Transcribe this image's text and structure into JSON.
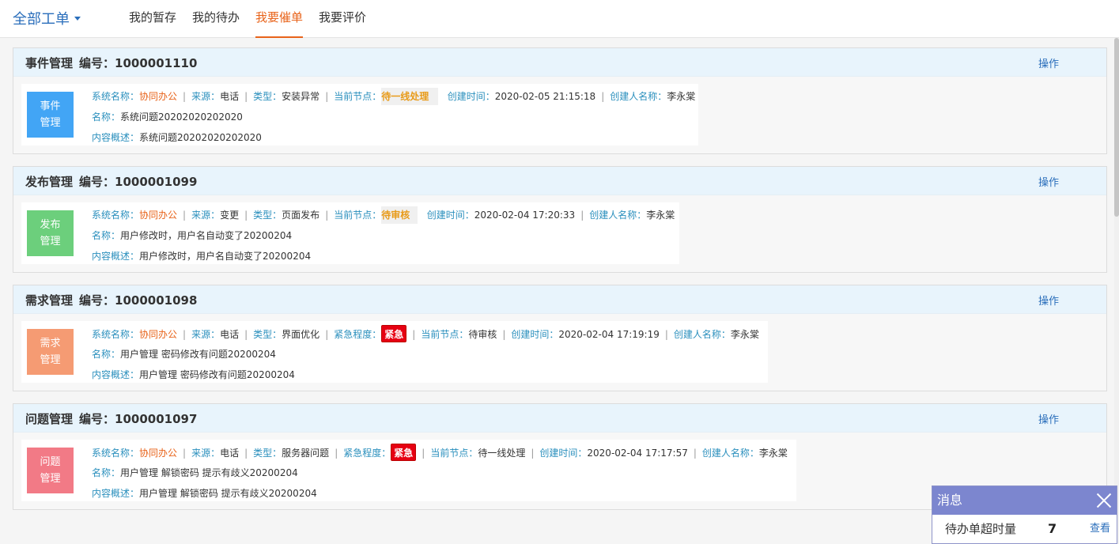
{
  "header": {
    "dropdown_label": "全部工单",
    "tabs": [
      {
        "label": "我的暂存"
      },
      {
        "label": "我的待办"
      },
      {
        "label": "我要催单"
      },
      {
        "label": "我要评价"
      }
    ]
  },
  "labels": {
    "number": "编号：",
    "operation": "操作",
    "system_name": "系统名称：",
    "source": "来源：",
    "type": "类型：",
    "current_node": "当前节点：",
    "urgency": "紧急程度：",
    "create_time": "创建时间：",
    "creator": "创建人名称：",
    "name": "名称：",
    "summary": "内容概述：",
    "separator": "|"
  },
  "tickets": [
    {
      "category": "事件管理",
      "badge_line1": "事件",
      "badge_line2": "管理",
      "badge_color": "#42a5f5",
      "number": "1000001110",
      "system_name": "协同办公",
      "source": "电话",
      "type": "安装异常",
      "current_node": "待一线处理",
      "create_time": "2020-02-05 21:15:18",
      "creator": "李永棠",
      "name": "系统问题20202020202020",
      "summary": "系统问题20202020202020"
    },
    {
      "category": "发布管理",
      "badge_line1": "发布",
      "badge_line2": "管理",
      "badge_color": "#6ccf7c",
      "number": "1000001099",
      "system_name": "协同办公",
      "source": "变更",
      "type": "页面发布",
      "current_node": "待审核",
      "create_time": "2020-02-04 17:20:33",
      "creator": "李永棠",
      "name": "用户修改时，用户名自动变了20200204",
      "summary": "用户修改时，用户名自动变了20200204"
    },
    {
      "category": "需求管理",
      "badge_line1": "需求",
      "badge_line2": "管理",
      "badge_color": "#f59b73",
      "number": "1000001098",
      "system_name": "协同办公",
      "source": "电话",
      "type": "界面优化",
      "urgency": "紧急",
      "current_node": "待审核",
      "create_time": "2020-02-04 17:19:19",
      "creator": "李永棠",
      "name": "用户管理 密码修改有问题20200204",
      "summary": "用户管理 密码修改有问题20200204"
    },
    {
      "category": "问题管理",
      "badge_line1": "问题",
      "badge_line2": "管理",
      "badge_color": "#f27a86",
      "number": "1000001097",
      "system_name": "协同办公",
      "source": "电话",
      "type": "服务器问题",
      "urgency": "紧急",
      "current_node": "待一线处理",
      "create_time": "2020-02-04 17:17:57",
      "creator": "李永棠",
      "name": "用户管理 解锁密码 提示有歧义20200204",
      "summary": "用户管理 解锁密码 提示有歧义20200204"
    }
  ],
  "message_box": {
    "title": "消息",
    "label": "待办单超时量",
    "count": "7",
    "view_label": "查看"
  },
  "colors": {
    "accent": "#e8631a",
    "link": "#2a6ebb",
    "urgent": "#e60012",
    "message_header": "#7c86cf"
  }
}
